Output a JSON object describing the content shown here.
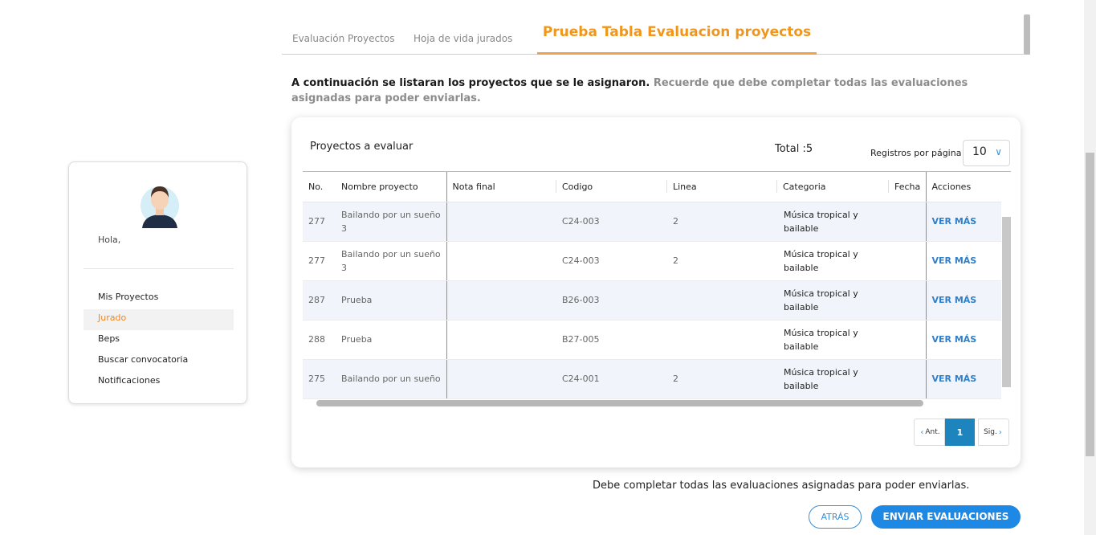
{
  "profile": {
    "greeting": "Hola,",
    "menu": [
      {
        "label": "Mis Proyectos",
        "active": false
      },
      {
        "label": "Jurado",
        "active": true
      },
      {
        "label": "Beps",
        "active": false
      },
      {
        "label": "Buscar convocatoria",
        "active": false
      },
      {
        "label": "Notificaciones",
        "active": false
      }
    ]
  },
  "tabs": [
    {
      "label": "Evaluación Proyectos"
    },
    {
      "label": "Hoja de vida jurados"
    },
    {
      "label": "Prueba Tabla Evaluacion proyectos",
      "active": true
    }
  ],
  "intro": {
    "strong": "A continuación se listaran los proyectos que se le asignaron.",
    "muted": "Recuerde que debe completar todas las evaluaciones asignadas para poder enviarlas."
  },
  "table_card": {
    "title": "Proyectos a evaluar",
    "total": "Total :5",
    "per_page_label": "Registros por página",
    "per_page_value": "10",
    "columns": [
      "No.",
      "Nombre proyecto",
      "Nota final",
      "Codigo",
      "Linea",
      "Categoria",
      "Fecha",
      "Acciones"
    ],
    "rows": [
      {
        "no": "277",
        "nombre": "Bailando por un sueño 3",
        "nota": "",
        "codigo": "C24-003",
        "linea": "2",
        "categoria": "Música tropical y bailable",
        "fecha": "",
        "accion": "VER MÁS"
      },
      {
        "no": "277",
        "nombre": "Bailando por un sueño 3",
        "nota": "",
        "codigo": "C24-003",
        "linea": "2",
        "categoria": "Música tropical y bailable",
        "fecha": "",
        "accion": "VER MÁS"
      },
      {
        "no": "287",
        "nombre": "Prueba",
        "nota": "",
        "codigo": "B26-003",
        "linea": "",
        "categoria": "Música tropical y bailable",
        "fecha": "",
        "accion": "VER MÁS"
      },
      {
        "no": "288",
        "nombre": "Prueba",
        "nota": "",
        "codigo": "B27-005",
        "linea": "",
        "categoria": "Música tropical y bailable",
        "fecha": "",
        "accion": "VER MÁS"
      },
      {
        "no": "275",
        "nombre": "Bailando por un sueño",
        "nota": "",
        "codigo": "C24-001",
        "linea": "2",
        "categoria": "Música tropical y bailable",
        "fecha": "",
        "accion": "VER MÁS"
      }
    ],
    "pager": {
      "prev": "Ant.",
      "current": "1",
      "next": "Sig."
    }
  },
  "footer": {
    "note": "Debe completar todas las evaluaciones asignadas para poder enviarlas.",
    "back_label": "ATRÁS",
    "send_label": "ENVIAR EVALUACIONES"
  },
  "colors": {
    "accent_orange": "#f0961c",
    "primary_blue": "#1e88e5",
    "pager_blue": "#1d84bd"
  }
}
